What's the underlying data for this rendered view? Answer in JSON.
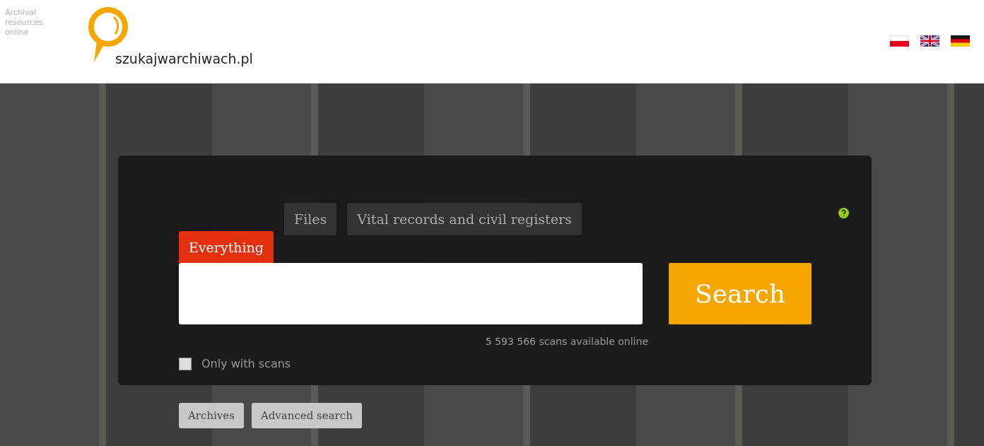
{
  "header": {
    "tagline": [
      "Archival",
      "resources",
      "online"
    ],
    "site_name": "szukajwarchiwach.pl"
  },
  "languages": [
    {
      "kind": "pl"
    },
    {
      "kind": "en"
    },
    {
      "kind": "de"
    }
  ],
  "search": {
    "tabs": [
      {
        "label": "Everything",
        "selected": true
      },
      {
        "label": "Files",
        "selected": false
      },
      {
        "label": "Vital records and civil registers",
        "selected": false
      }
    ],
    "button": "Search",
    "scan_count": "5 593 566 scans available online",
    "only_with_scans": {
      "label": "Only with scans",
      "checked": false
    }
  },
  "links": [
    "Archives",
    "Advanced search"
  ]
}
